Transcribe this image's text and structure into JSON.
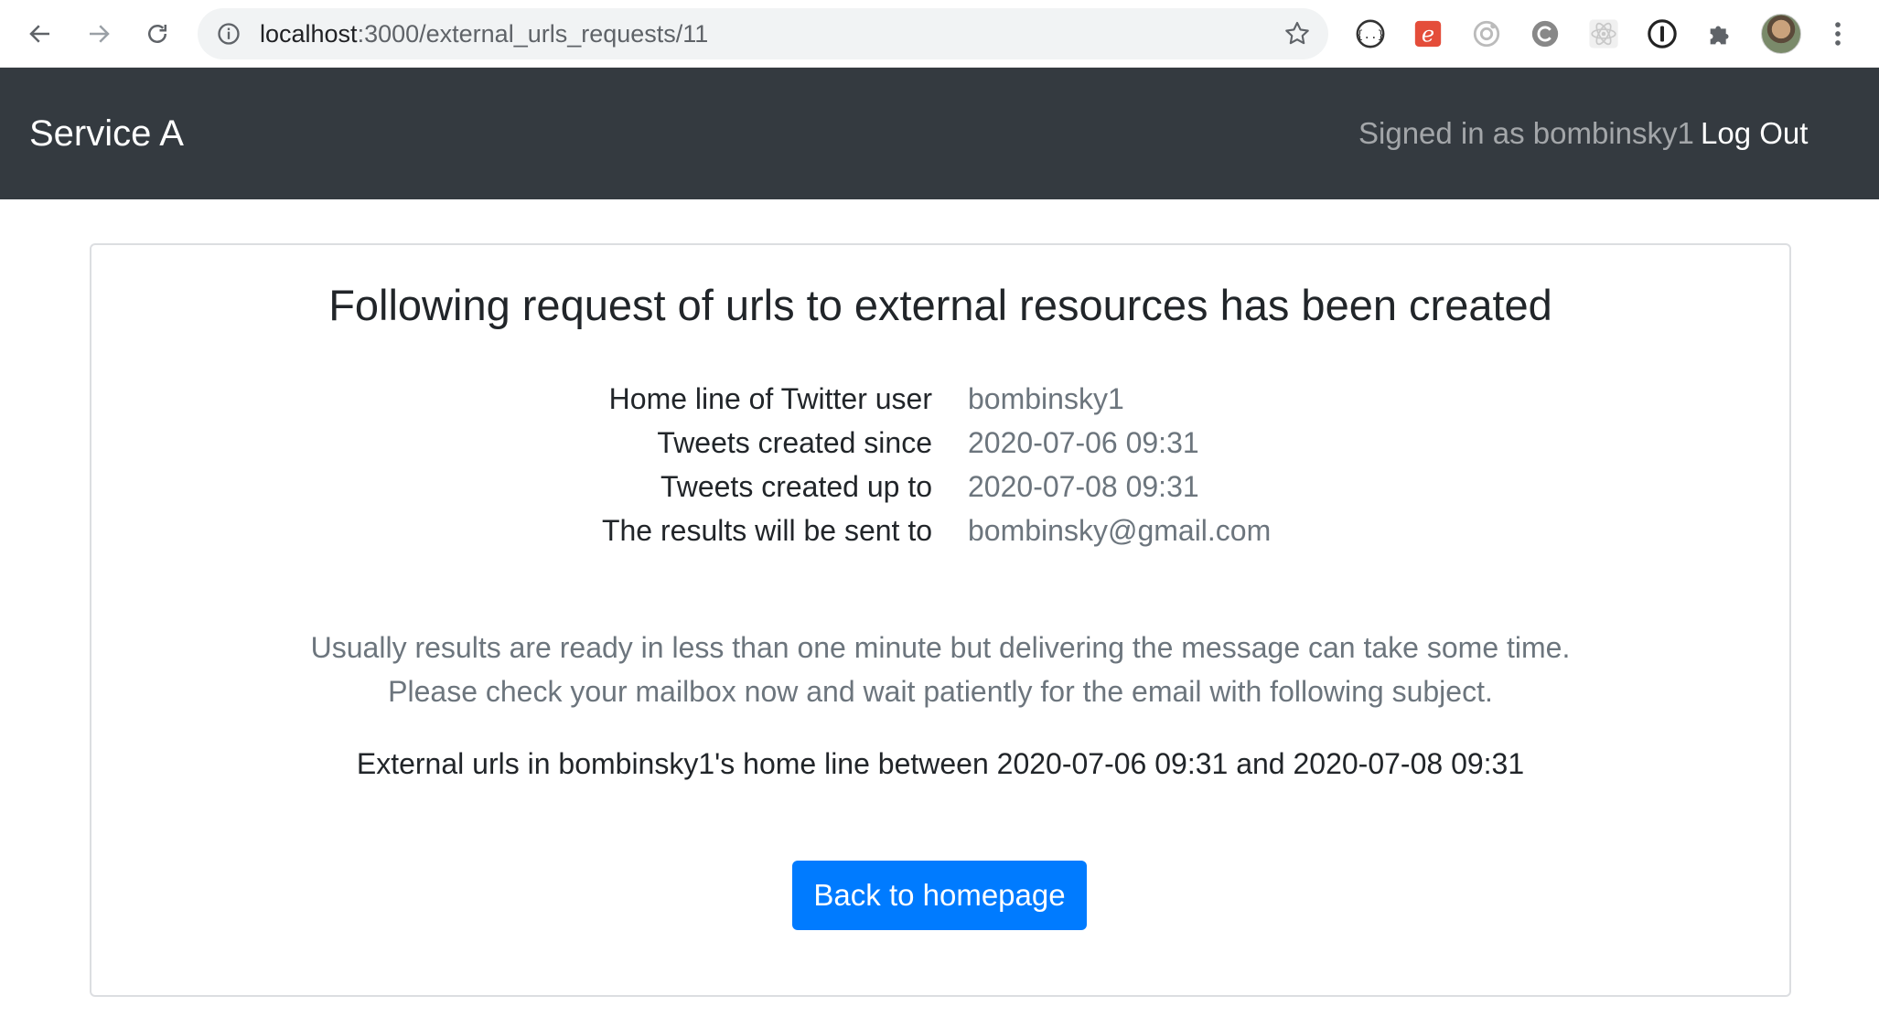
{
  "browser": {
    "url_host": "localhost",
    "url_path": ":3000/external_urls_requests/11",
    "icons": [
      "back-arrow-icon",
      "forward-arrow-icon",
      "reload-icon",
      "info-icon",
      "star-icon",
      "extension-braces-icon",
      "extension-e-icon",
      "extension-target-icon",
      "extension-swirl-icon",
      "extension-react-icon",
      "extension-password-icon",
      "extensions-puzzle-icon",
      "profile-avatar",
      "more-vert-icon"
    ]
  },
  "navbar": {
    "brand": "Service A",
    "signed_in_text": "Signed in as bombinsky1",
    "logout_label": "Log Out",
    "background": "#343a40"
  },
  "main": {
    "title": "Following request of urls to external resources has been created",
    "details": [
      {
        "label": "Home line of Twitter user",
        "value": "bombinsky1"
      },
      {
        "label": "Tweets created since",
        "value": "2020-07-06 09:31"
      },
      {
        "label": "Tweets created up to",
        "value": "2020-07-08 09:31"
      },
      {
        "label": "The results will be sent to",
        "value": "bombinsky@gmail.com"
      }
    ],
    "note_line1": "Usually results are ready in less than one minute but delivering the message can take some time.",
    "note_line2": "Please check your mailbox now and wait patiently for the email with following subject.",
    "email_subject": "External urls in bombinsky1's home line between 2020-07-06 09:31 and 2020-07-08 09:31",
    "back_button_label": "Back to homepage",
    "accent": "#007bff"
  }
}
